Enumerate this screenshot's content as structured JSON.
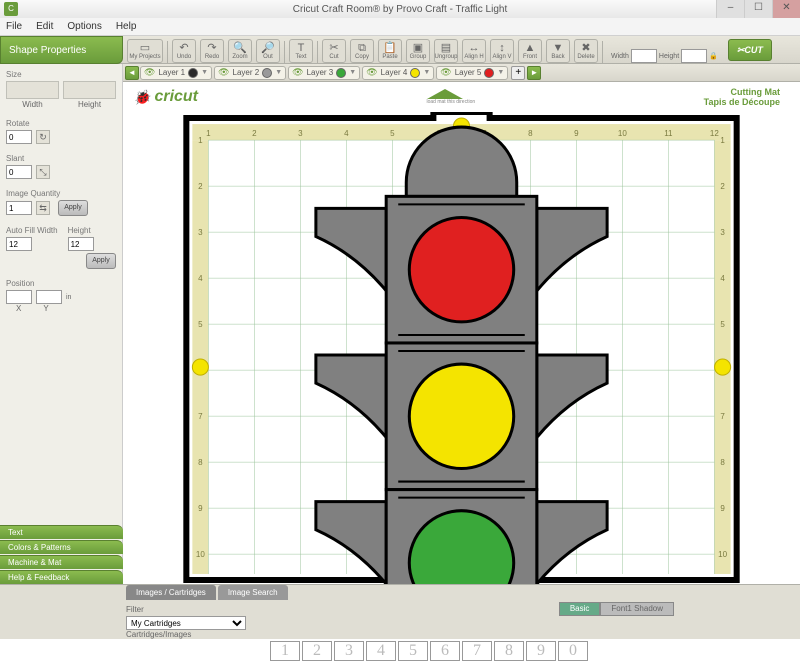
{
  "window": {
    "title": "Cricut Craft Room® by Provo Craft - Traffic Light",
    "app_letter": "C"
  },
  "menu": {
    "file": "File",
    "edit": "Edit",
    "options": "Options",
    "help": "Help"
  },
  "panels": {
    "shape_header": "Shape Properties",
    "size_label": "Size",
    "width_label": "Width",
    "height_label": "Height",
    "rotate_label": "Rotate",
    "rotate_value": "0",
    "slant_label": "Slant",
    "slant_value": "0",
    "image_qty_label": "Image Quantity",
    "image_qty_value": "1",
    "autofill_label": "Auto Fill Width",
    "autofill_value": "12",
    "height2_label": "Height",
    "height2_value": "12",
    "position_label": "Position",
    "posx_label": "X",
    "posy_label": "Y",
    "apply_label": "Apply"
  },
  "side": {
    "text": "Text",
    "colors": "Colors & Patterns",
    "machine": "Machine & Mat",
    "help": "Help & Feedback"
  },
  "toolbar": {
    "myprojects": "My Projects",
    "undo": "Undo",
    "redo": "Redo",
    "zoom": "Zoom",
    "out": "Out",
    "text": "Text",
    "cut": "Cut",
    "copy": "Copy",
    "paste": "Paste",
    "group": "Group",
    "ungroup": "Ungroup",
    "alignh": "Align H",
    "alignv": "Align V",
    "front": "Front",
    "back": "Back",
    "delete": "Delete",
    "width": "Width",
    "height": "Height",
    "width_value": "",
    "height_value": "",
    "cutbtn": "CUT"
  },
  "layers": [
    {
      "name": "Layer 1",
      "color": "#2a2a2a"
    },
    {
      "name": "Layer 2",
      "color": "#9a9a9a"
    },
    {
      "name": "Layer 3",
      "color": "#3aa83a"
    },
    {
      "name": "Layer 4",
      "color": "#f4e400"
    },
    {
      "name": "Layer 5",
      "color": "#e02020"
    }
  ],
  "mat": {
    "brand": "cricut",
    "title": "Cutting Mat",
    "subtitle": "Tapis de Découpe",
    "ruler_max": 11
  },
  "design": {
    "lights": [
      {
        "name": "red",
        "color": "#e02020"
      },
      {
        "name": "yellow",
        "color": "#f4e400"
      },
      {
        "name": "green",
        "color": "#3aa83a"
      }
    ],
    "body_color": "#808080"
  },
  "bottom": {
    "tab1": "Images / Cartridges",
    "tab2": "Image Search",
    "filter_label": "Filter",
    "filter_value": "My Cartridges",
    "cart_label": "Cartridges/Images",
    "mode_basic": "Basic",
    "mode_shadow": "Font1 Shadow",
    "glyphs": [
      "1",
      "2",
      "3",
      "4",
      "5",
      "6",
      "7",
      "8",
      "9",
      "0"
    ]
  }
}
